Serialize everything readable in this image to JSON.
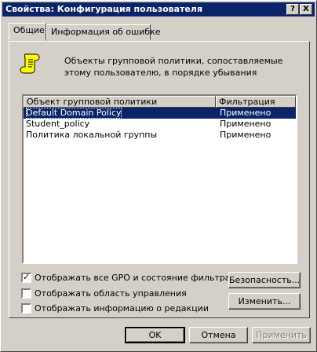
{
  "window": {
    "title": "Свойства: Конфигурация пользователя",
    "help_label": "?",
    "close_label": "X"
  },
  "tabs": [
    {
      "label": "Общие",
      "active": true
    },
    {
      "label": "Информация об ошибке",
      "active": false
    }
  ],
  "description": {
    "line1": "Объекты групповой политики, сопоставляемые",
    "line2": "этому пользователю, в порядке убывания"
  },
  "list": {
    "columns": [
      "Объект групповой политики",
      "Фильтрация"
    ],
    "rows": [
      {
        "name": "Default Domain Policy",
        "filter": "Применено",
        "selected": true
      },
      {
        "name": "Student_policy",
        "filter": "Применено",
        "selected": false
      },
      {
        "name": "Политика локальной группы",
        "filter": "Применено",
        "selected": false
      }
    ]
  },
  "options": {
    "show_all_gpo": {
      "label": "Отображать все GPO и состояние фильтрации",
      "checked": true
    },
    "show_scope": {
      "label": "Отображать область управления",
      "checked": false
    },
    "show_revision": {
      "label": "Отображать информацию о редакции",
      "checked": false
    }
  },
  "buttons": {
    "security": "Безопасность...",
    "edit": "Изменить...",
    "ok": "OK",
    "cancel": "Отмена",
    "apply": "Применить"
  },
  "icons": {
    "info": "scroll-icon"
  }
}
